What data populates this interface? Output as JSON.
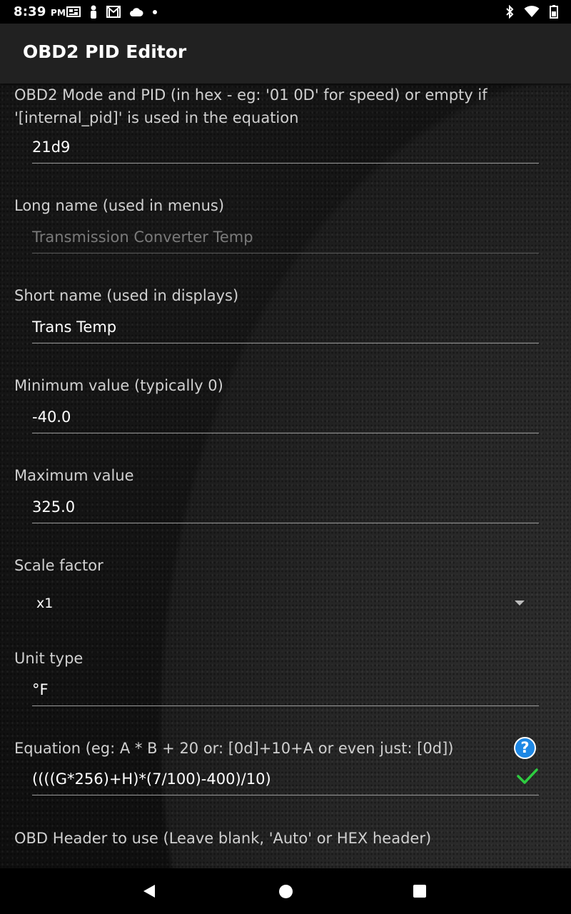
{
  "status_bar": {
    "time": "8:39",
    "ampm": "PM",
    "left_icons": [
      "news-icon",
      "person-icon",
      "gmail-icon",
      "cloud-icon",
      "dot-icon"
    ],
    "right_icons": [
      "bluetooth-icon",
      "wifi-icon",
      "battery-icon"
    ]
  },
  "app_bar": {
    "title": "OBD2 PID Editor"
  },
  "form": {
    "pid": {
      "label": "OBD2 Mode and PID (in hex - eg: '01 0D' for speed) or empty if '[internal_pid]' is used in the equation",
      "value": "21d9"
    },
    "long_name": {
      "label": "Long name (used in menus)",
      "value": "Transmission Converter Temp"
    },
    "short_name": {
      "label": "Short name (used in displays)",
      "value": "Trans Temp"
    },
    "min_value": {
      "label": "Minimum value (typically 0)",
      "value": "-40.0"
    },
    "max_value": {
      "label": "Maximum value",
      "value": "325.0"
    },
    "scale_factor": {
      "label": "Scale factor",
      "value": "x1"
    },
    "unit_type": {
      "label": "Unit type",
      "value": "°F"
    },
    "equation": {
      "label": "Equation (eg:  A * B + 20   or: [0d]+10+A  or even just: [0d])",
      "value": "((((G*256)+H)*(7/100)-400)/10)",
      "help_glyph": "?"
    },
    "obd_header": {
      "label": "OBD Header to use (Leave blank, 'Auto' or HEX header)"
    }
  },
  "colors": {
    "help_blue": "#1e88e5",
    "check_green": "#2ecc40",
    "appbar_bg": "#212121"
  }
}
